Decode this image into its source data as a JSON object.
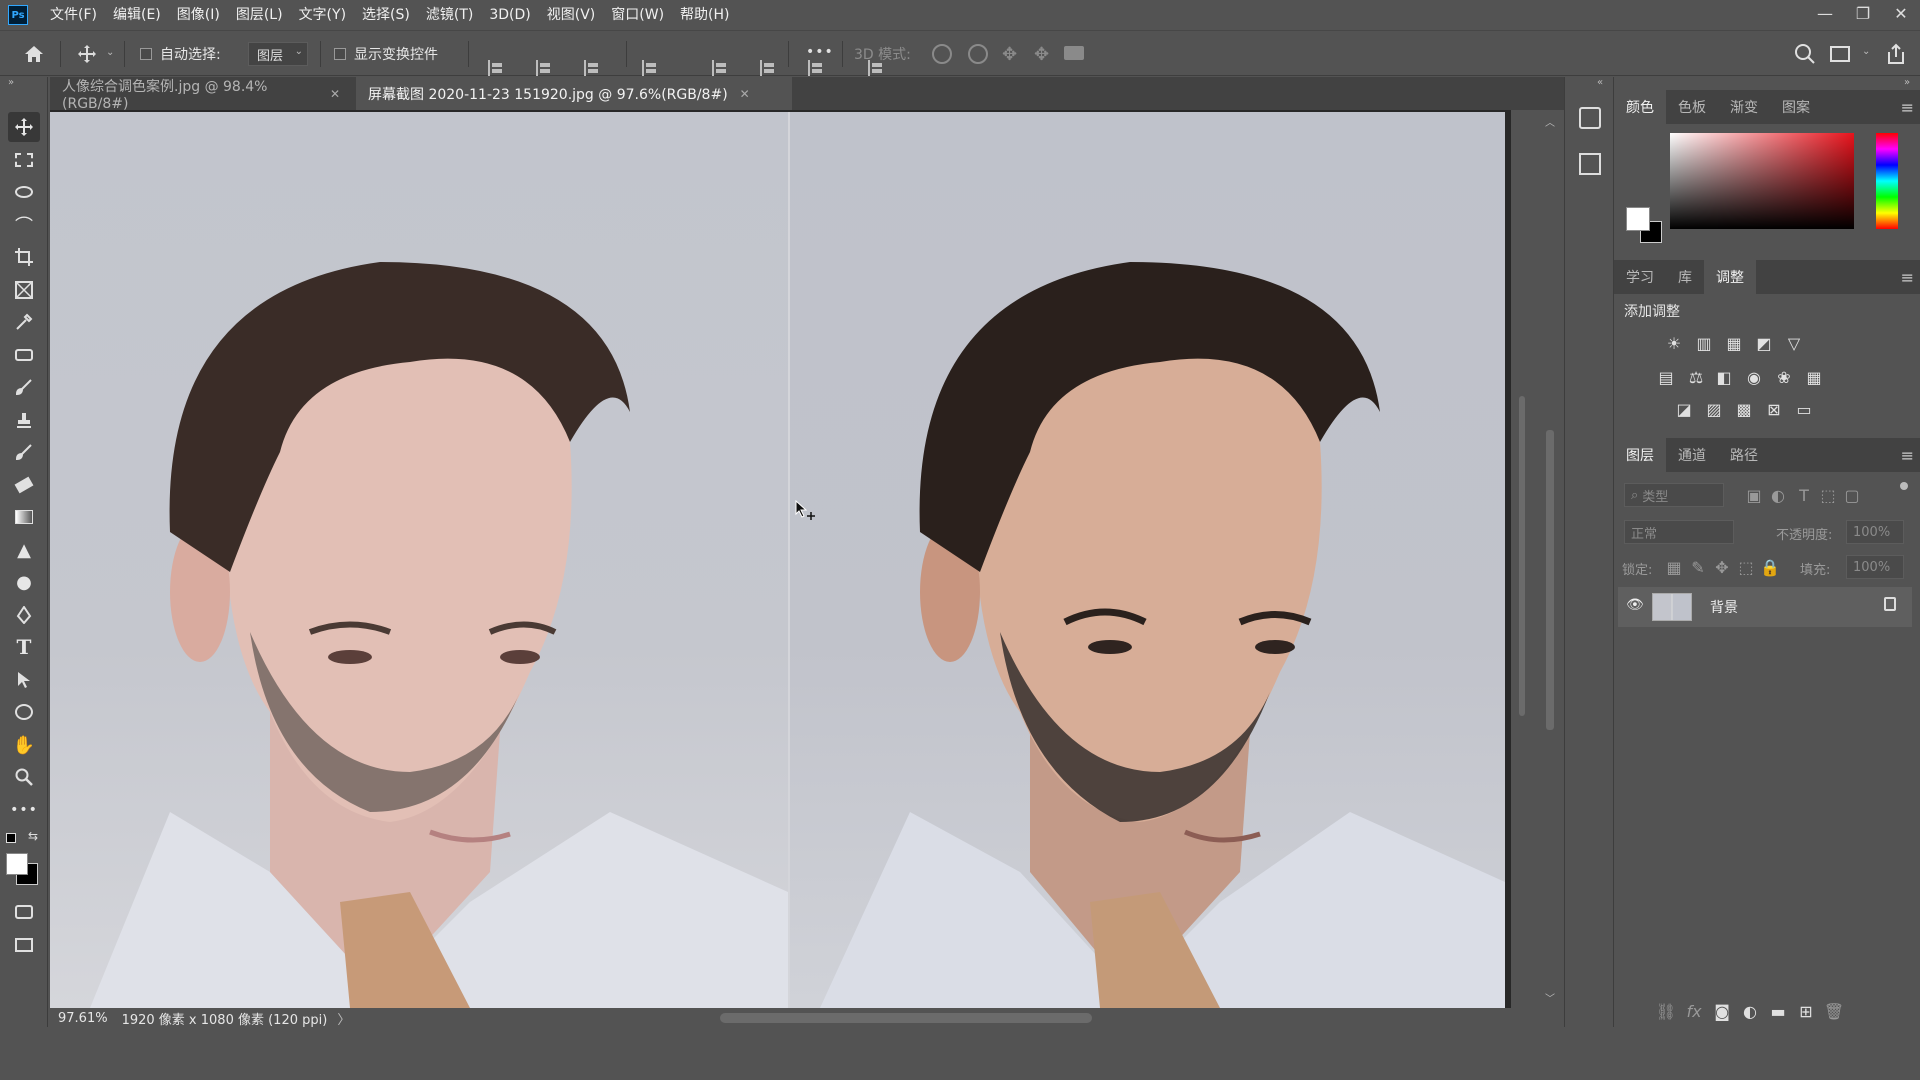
{
  "app": {
    "logo": "Ps",
    "menu": [
      "文件(F)",
      "编辑(E)",
      "图像(I)",
      "图层(L)",
      "文字(Y)",
      "选择(S)",
      "滤镜(T)",
      "3D(D)",
      "视图(V)",
      "窗口(W)",
      "帮助(H)"
    ],
    "window_controls": [
      "—",
      "❐",
      "✕"
    ]
  },
  "options": {
    "auto_select_label": "自动选择:",
    "auto_select_value": "图层",
    "show_transform_label": "显示变换控件",
    "mode_3d_label": "3D 模式:",
    "more": "•••"
  },
  "tabs": [
    {
      "label": "人像综合调色案例.jpg @ 98.4%(RGB/8#)",
      "close": "✕"
    },
    {
      "label": "屏幕截图 2020-11-23 151920.jpg @ 97.6%(RGB/8#)",
      "close": "✕"
    }
  ],
  "status": {
    "zoom": "97.61%",
    "doc_info": "1920 像素 x 1080 像素 (120 ppi)",
    "arrow": "〉"
  },
  "panels": {
    "color_tabs": [
      "颜色",
      "色板",
      "渐变",
      "图案"
    ],
    "adjust_tabs": [
      "学习",
      "库",
      "调整"
    ],
    "add_adjustment": "添加调整",
    "layer_tabs": [
      "图层",
      "通道",
      "路径"
    ],
    "filter_kind": "类型",
    "blend_mode": "正常",
    "opacity_label": "不透明度:",
    "opacity_value": "100%",
    "lock_label": "锁定:",
    "fill_label": "填充:",
    "fill_value": "100%",
    "layer_name": "背景"
  },
  "colors": {
    "accent": "#31a8ff",
    "ui_bg": "#535353",
    "ui_dark": "#424242"
  }
}
